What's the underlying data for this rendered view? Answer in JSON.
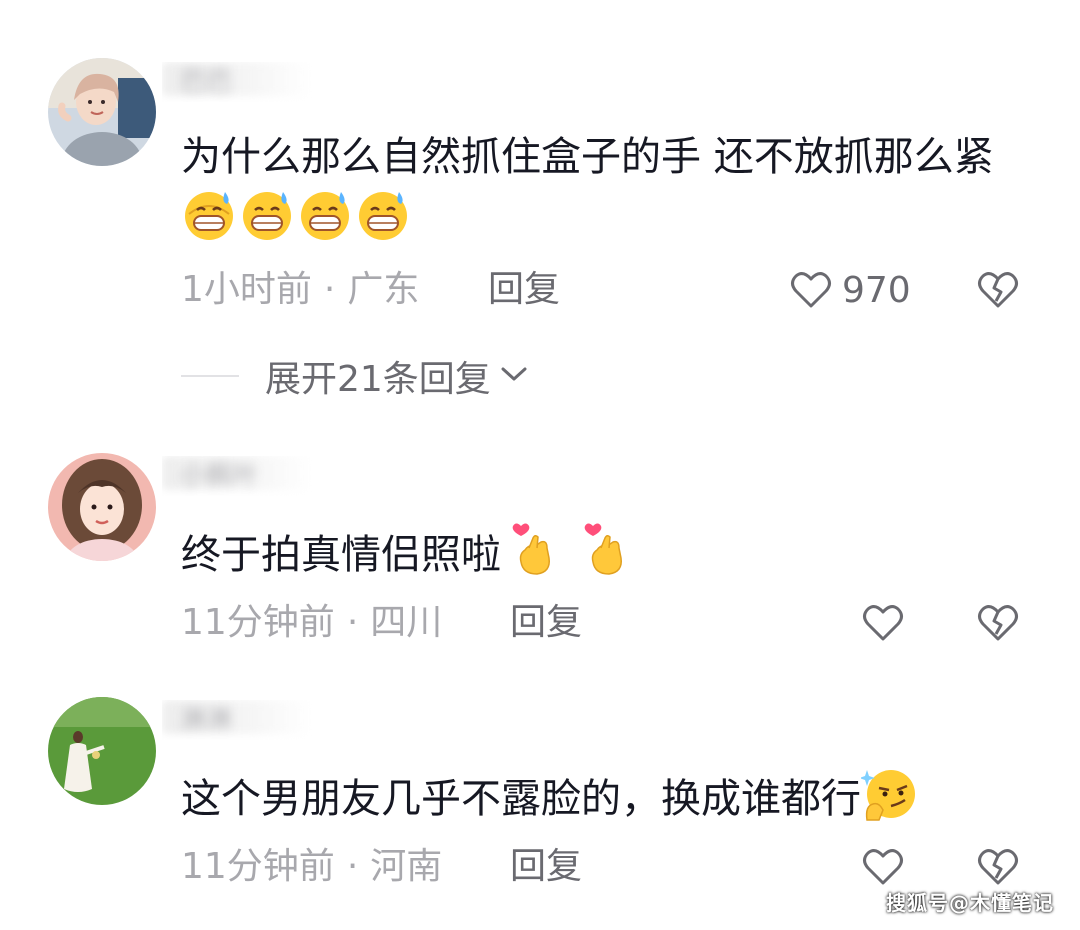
{
  "comments": [
    {
      "username": "巴巴",
      "text_parts": [
        "为什么那么自然抓住盒子的手 还不放抓那么紧"
      ],
      "emojis": [
        "grinning-sweat-emoji",
        "grinning-sweat-emoji",
        "grinning-sweat-emoji",
        "grinning-sweat-emoji"
      ],
      "time": "1小时前",
      "location": "广东",
      "reply_label": "回复",
      "like_count": "970"
    },
    {
      "username": "小枫叶",
      "text_parts": [
        "终于拍真情侣照啦"
      ],
      "emojis": [
        "finger-heart-emoji",
        "finger-heart-emoji"
      ],
      "time": "11分钟前",
      "location": "四川",
      "reply_label": "回复",
      "like_count": ""
    },
    {
      "username": "淋淋",
      "text_parts": [
        "这个男朋友几乎不露脸的，换成谁都行"
      ],
      "emojis": [
        "smirk-thinking-emoji"
      ],
      "time": "11分钟前",
      "location": "河南",
      "reply_label": "回复",
      "like_count": ""
    }
  ],
  "expand_replies": {
    "label": "展开21条回复"
  },
  "separator_dot": "·",
  "watermark": "搜狐号@木懂笔记",
  "icons": {
    "like": "heart-outline-icon",
    "dislike": "broken-heart-icon",
    "expand": "chevron-down-icon"
  },
  "colors": {
    "text": "#161823",
    "meta": "#a8a8ad",
    "action": "#6a6a70"
  }
}
